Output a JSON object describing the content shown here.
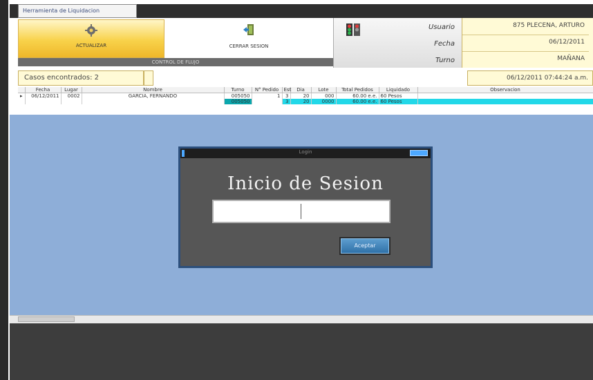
{
  "window": {
    "tab_label": "Herramienta de Liquidacion"
  },
  "toolbar": {
    "actualizar_label": "ACTUALIZAR",
    "cerrar_label": "CERRAR SESION",
    "group_label": "CONTROL DE FLUJO"
  },
  "session": {
    "usuario_label": "Usuario",
    "fecha_label": "Fecha",
    "turno_label": "Turno",
    "usuario_value": "875 PLECENA, ARTURO",
    "fecha_value": "06/12/2011",
    "turno_value": "MAÑANA"
  },
  "status": {
    "cases_found": "Casos encontrados: 2",
    "datetime": "06/12/2011 07:44:24 a.m."
  },
  "grid": {
    "columns": [
      "Fecha",
      "Lugar",
      "Nombre",
      "Turno",
      "N° Pedido",
      "Est",
      "Dia",
      "Lote",
      "Total Pedidos",
      "Liquidado",
      "Observacion"
    ],
    "rows": [
      [
        "06/12/2011",
        "0002",
        "GARCIA, FERNANDO",
        "005050",
        "1",
        "3",
        "20",
        "000",
        "60.00 e.e.",
        "60 Pesos",
        ""
      ],
      [
        "",
        "",
        "",
        "005050",
        "",
        "3",
        "20",
        "0000",
        "60.00 e.e.",
        "60 Pesos",
        ""
      ]
    ]
  },
  "login_dialog": {
    "window_title": "Login",
    "heading": "Inicio de Sesion",
    "password_value": "",
    "accept_label": "Aceptar"
  },
  "colors": {
    "accent_blue": "#8eaed8",
    "dialog_bg": "#565656",
    "highlight_cyan": "#22d8e8"
  }
}
